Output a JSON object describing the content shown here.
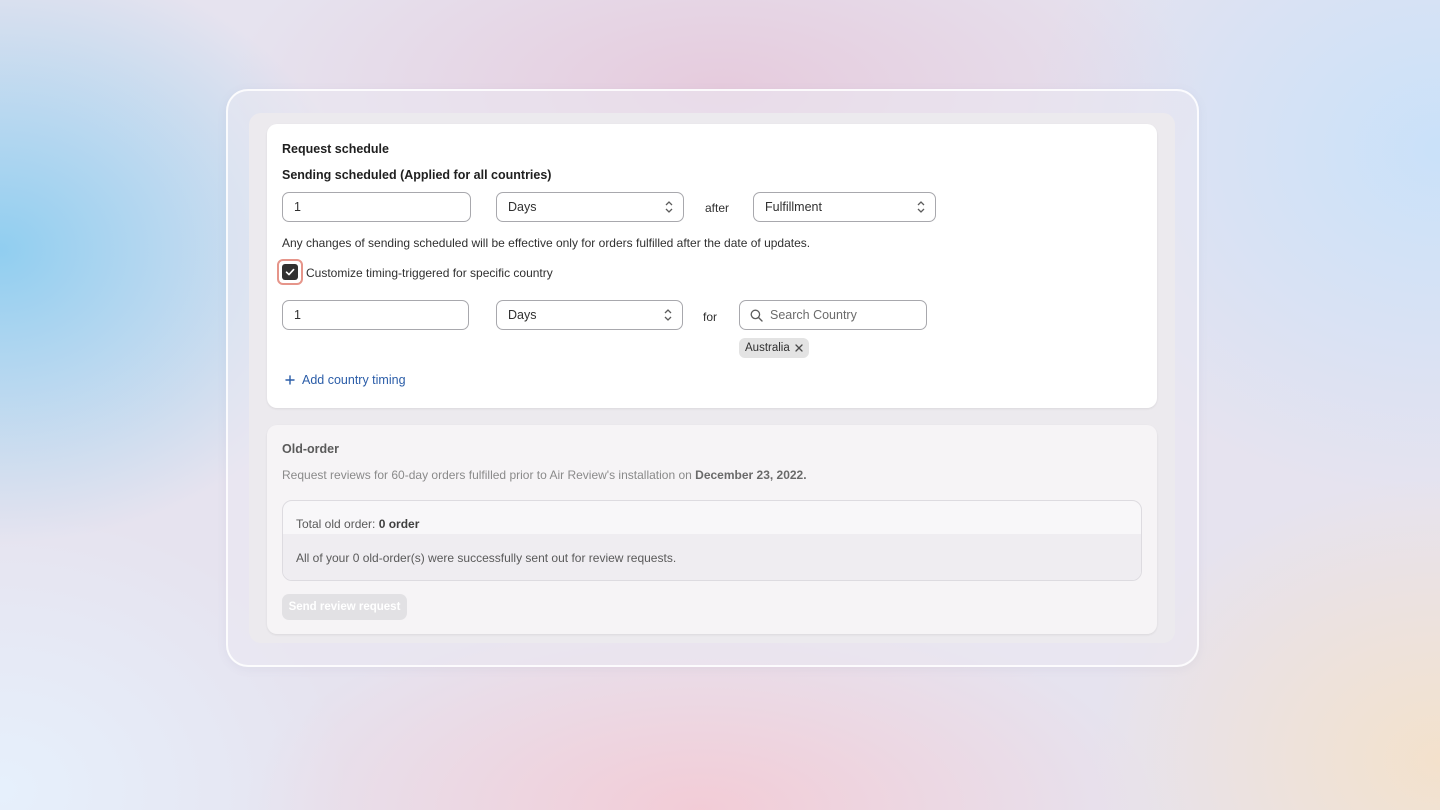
{
  "request_schedule": {
    "title": "Request schedule",
    "subtitle": "Sending scheduled (Applied for all countries)",
    "amount_value": "1",
    "unit_value": "Days",
    "after_label": "after",
    "trigger_value": "Fulfillment",
    "note": "Any changes of sending scheduled will be effective only for orders fulfilled after the date of updates.",
    "customize_checked": true,
    "customize_label": "Customize timing-triggered for specific country",
    "country_row": {
      "amount_value": "1",
      "unit_value": "Days",
      "for_label": "for",
      "search_placeholder": "Search Country",
      "selected_countries": [
        "Australia"
      ]
    },
    "add_country_label": "Add country timing"
  },
  "old_order": {
    "title": "Old-order",
    "description_prefix": "Request reviews for 60-day orders fulfilled prior to Air Review's installation on ",
    "description_date": "December 23, 2022.",
    "total_label": "Total old order: ",
    "total_value": "0 order",
    "status_message": "All of your 0 old-order(s) were successfully sent out for review requests.",
    "send_button_label": "Send review request"
  },
  "colors": {
    "link": "#2b5da8",
    "checkbox_focus_ring": "#e6958a",
    "checkbox_fill": "#303030"
  }
}
